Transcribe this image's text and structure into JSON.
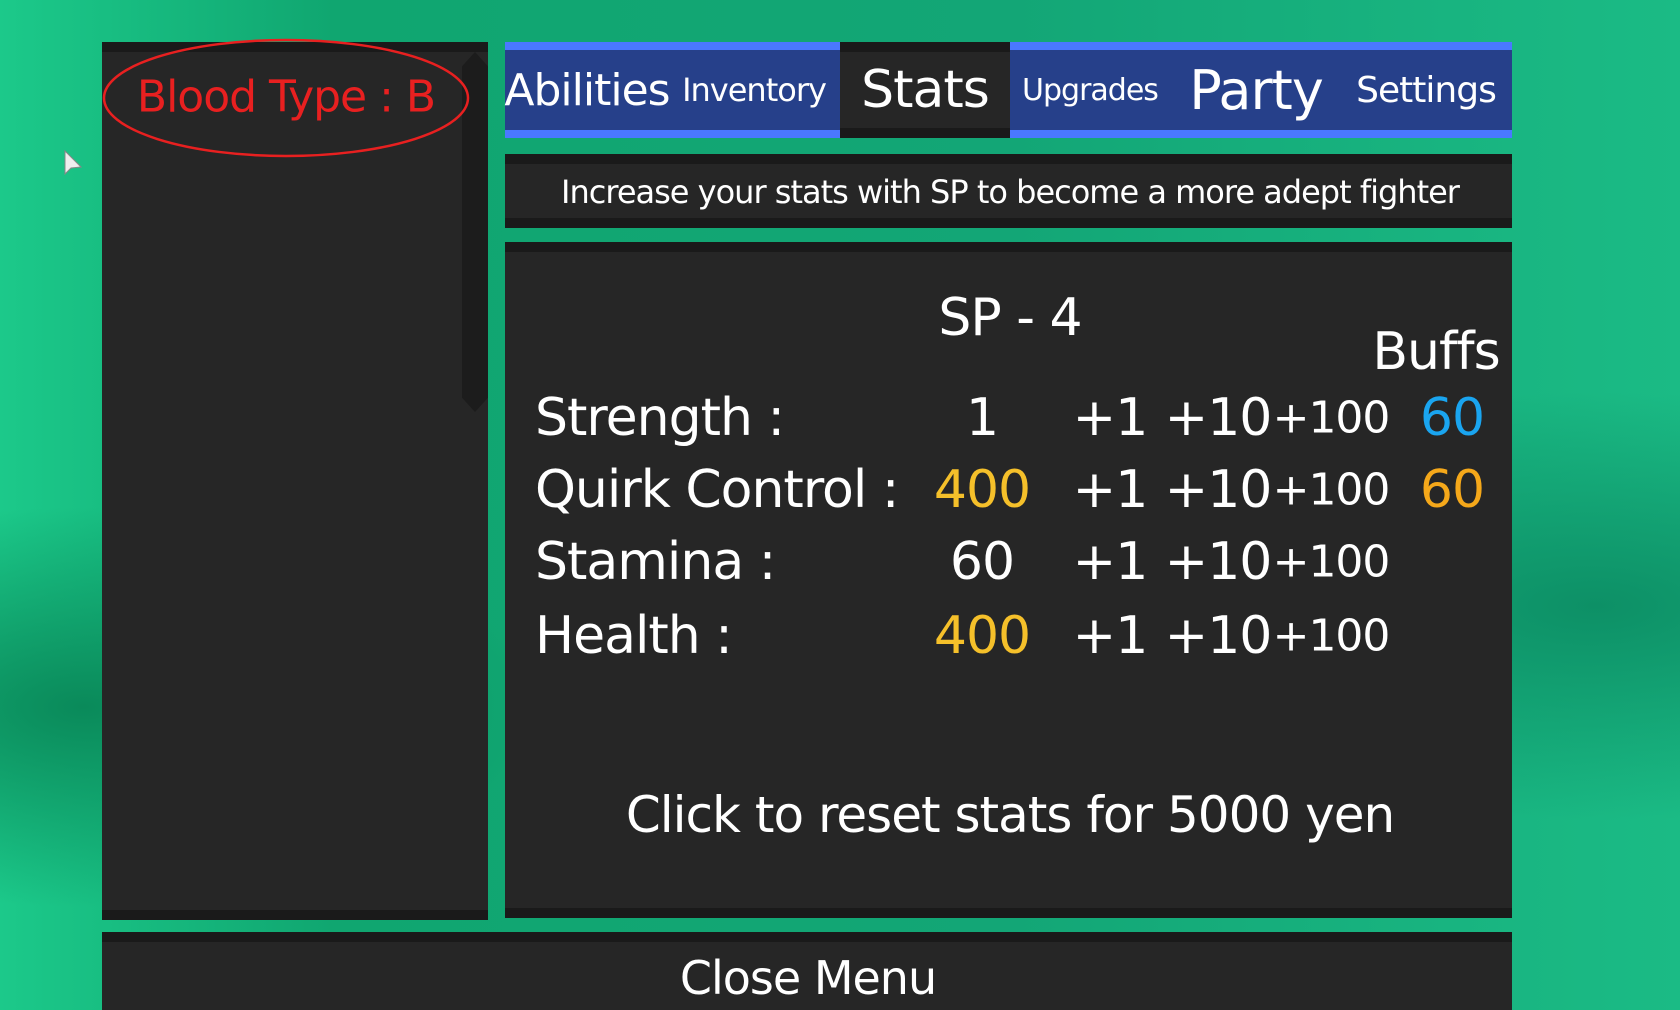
{
  "side": {
    "blood_type": "Blood Type : B"
  },
  "tabs": [
    {
      "label": "Abilities"
    },
    {
      "label": "Inventory"
    },
    {
      "label": "Stats",
      "active": true
    },
    {
      "label": "Upgrades"
    },
    {
      "label": "Party"
    },
    {
      "label": "Settings"
    }
  ],
  "description": "Increase your stats with SP to become a more adept fighter",
  "stats": {
    "sp": "SP - 4",
    "buffs_header": "Buffs",
    "rows": [
      {
        "label": "Strength :",
        "value": "1",
        "buff": "60"
      },
      {
        "label": "Quirk Control :",
        "value": "400",
        "buff": "60"
      },
      {
        "label": "Stamina :",
        "value": "60"
      },
      {
        "label": "Health :",
        "value": "400"
      }
    ],
    "inc": [
      "+1",
      "+10",
      "+100"
    ],
    "reset": "Click to reset stats for 5000 yen"
  },
  "close": "Close Menu",
  "colors": {
    "tab_bar": "#26408a",
    "tab_border": "#4a78ff",
    "panel": "#262626",
    "highlight_yellow": "#f5c02a",
    "buff_blue": "#1aa5f0",
    "buff_orange": "#f5a81a",
    "annotation_red": "#e82020"
  }
}
